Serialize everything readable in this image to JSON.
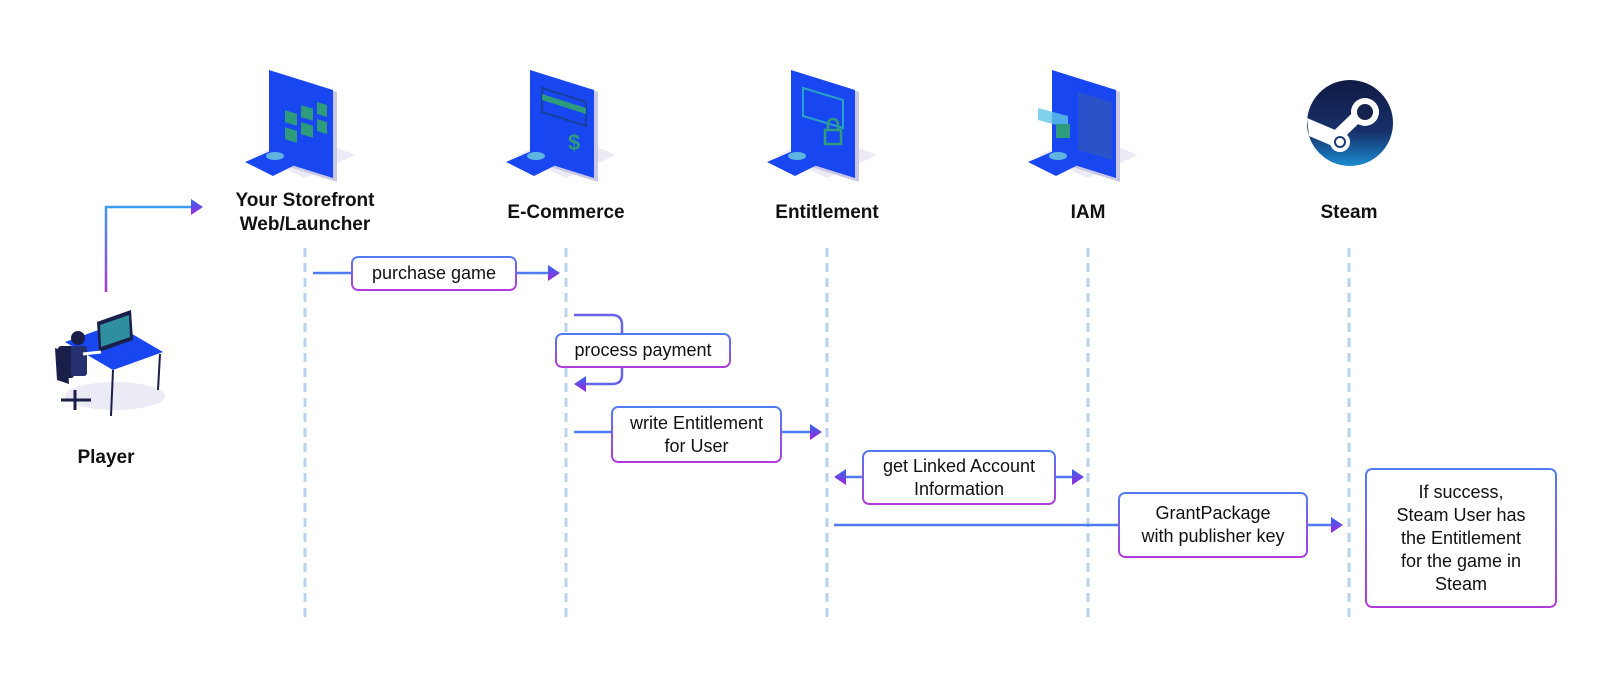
{
  "actors": [
    {
      "id": "player",
      "label": "Player",
      "icon": "player-at-desk-icon"
    },
    {
      "id": "storefront",
      "label": "Your Storefront\nWeb/Launcher",
      "icon": "storefront-monitor-icon"
    },
    {
      "id": "ecommerce",
      "label": "E-Commerce",
      "icon": "ecommerce-monitor-icon"
    },
    {
      "id": "entitlement",
      "label": "Entitlement",
      "icon": "entitlement-monitor-icon"
    },
    {
      "id": "iam",
      "label": "IAM",
      "icon": "iam-monitor-icon"
    },
    {
      "id": "steam",
      "label": "Steam",
      "icon": "steam-logo-icon"
    }
  ],
  "messages": [
    {
      "id": "purchase",
      "label": "purchase game",
      "from": "storefront",
      "to": "ecommerce"
    },
    {
      "id": "process",
      "label": "process payment",
      "from": "ecommerce",
      "to": "ecommerce"
    },
    {
      "id": "write",
      "label": "write Entitlement\nfor User",
      "from": "ecommerce",
      "to": "entitlement"
    },
    {
      "id": "linked",
      "label": "get Linked Account\nInformation",
      "from": "entitlement",
      "to": "iam",
      "bidirectional": true
    },
    {
      "id": "grant",
      "label": "GrantPackage\nwith publisher key",
      "from": "entitlement",
      "to": "steam"
    }
  ],
  "note": {
    "label": "If success,\nSteam User has\nthe Entitlement\nfor the game in\nSteam"
  },
  "colors": {
    "line": "#4f7cf2",
    "lifeline": "#b9d3ee",
    "arrow_start": "#2f6bf0",
    "arrow_end": "#a224d6",
    "monitor": "#1846f0",
    "steam_dark": "#14224d",
    "steam_light": "#1b8bd0"
  }
}
